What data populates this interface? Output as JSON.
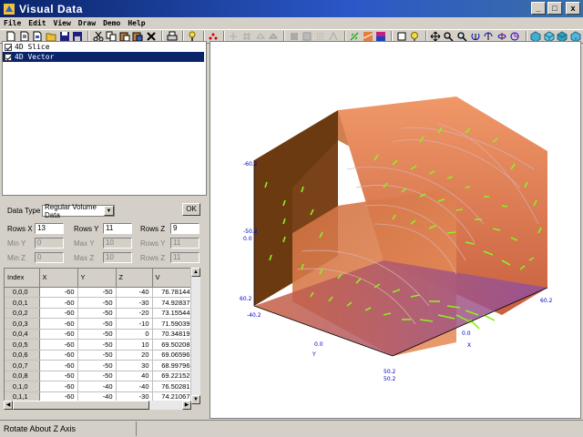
{
  "window": {
    "title": "Visual Data",
    "minimize": "_",
    "maximize": "□",
    "close": "x"
  },
  "menu": [
    "File",
    "Edit",
    "View",
    "Draw",
    "Demo",
    "Help"
  ],
  "toolbar": [
    "new-icon",
    "open-icon",
    "open-file-icon",
    "open-folder-icon",
    "save-icon",
    "save-as-icon",
    "cut-icon",
    "copy-icon",
    "paste-icon",
    "paste-special-icon",
    "delete-icon",
    "print-icon",
    "help-icon",
    "points-icon",
    "wireframe-icon",
    "grid-icon",
    "mesh-icon",
    "surface-icon",
    "solid-icon",
    "shaded-icon",
    "scatter-icon",
    "slice-icon",
    "vector-icon",
    "contour-icon",
    "light-icon",
    "move-icon",
    "zoom-icon",
    "zoom-box-icon",
    "rotate-x-icon",
    "rotate-y-icon",
    "rotate-z-icon",
    "rotate-icon",
    "view-iso-icon",
    "view-front-icon",
    "view-side-icon",
    "view-top-icon"
  ],
  "tree": {
    "items": [
      {
        "label": "4D Slice",
        "checked": true,
        "selected": false
      },
      {
        "label": "4D Vector",
        "checked": true,
        "selected": true
      }
    ]
  },
  "panel": {
    "data_type_label": "Data Type",
    "data_type_value": "Regular Volume Data",
    "ok_label": "OK",
    "rows_x_label": "Rows X",
    "rows_x_value": "13",
    "rows_y_label": "Rows Y",
    "rows_y_value": "11",
    "rows_z_label": "Rows Z",
    "rows_z_value": "9",
    "min_y_label": "Min Y",
    "min_y_value": "0",
    "max_y_label": "Max Y",
    "max_y_value": "10",
    "rows_y2_label": "Rows Y",
    "rows_y2_value": "11",
    "min_z_label": "Min Z",
    "min_z_value": "0",
    "max_z_label": "Max Z",
    "max_z_value": "10",
    "rows_z2_label": "Rows Z",
    "rows_z2_value": "11"
  },
  "table": {
    "headers": [
      "Index",
      "X",
      "Y",
      "Z",
      "V"
    ],
    "rows": [
      [
        "0,0,0",
        "-60",
        "-50",
        "-40",
        "76.78144"
      ],
      [
        "0,0,1",
        "-60",
        "-50",
        "-30",
        "74.92837"
      ],
      [
        "0,0,2",
        "-60",
        "-50",
        "-20",
        "73.15544"
      ],
      [
        "0,0,3",
        "-60",
        "-50",
        "-10",
        "71.59039"
      ],
      [
        "0,0,4",
        "-60",
        "-50",
        "0",
        "70.34819"
      ],
      [
        "0,0,5",
        "-60",
        "-50",
        "10",
        "69.50208"
      ],
      [
        "0,0,6",
        "-60",
        "-50",
        "20",
        "69.06596"
      ],
      [
        "0,0,7",
        "-60",
        "-50",
        "30",
        "68.99796"
      ],
      [
        "0,0,8",
        "-60",
        "-50",
        "40",
        "69.22152"
      ],
      [
        "0,1,0",
        "-60",
        "-40",
        "-40",
        "76.50281"
      ],
      [
        "0,1,1",
        "-60",
        "-40",
        "-30",
        "74.21067"
      ]
    ]
  },
  "plot": {
    "axis_labels": {
      "x": "X",
      "y": "Y"
    },
    "tick_labels": [
      "-60.2",
      "-50.2",
      "60.2",
      "-40.2",
      "60.2",
      "50.2",
      "0.0",
      "0.0",
      "0.0",
      "50.2"
    ],
    "colors": {
      "face_dark": "#6b3a10",
      "face_light": "#e07a4a",
      "vector": "#8cf020",
      "contour": "#d8b0b0"
    }
  },
  "status": {
    "text": "Rotate About Z Axis"
  }
}
